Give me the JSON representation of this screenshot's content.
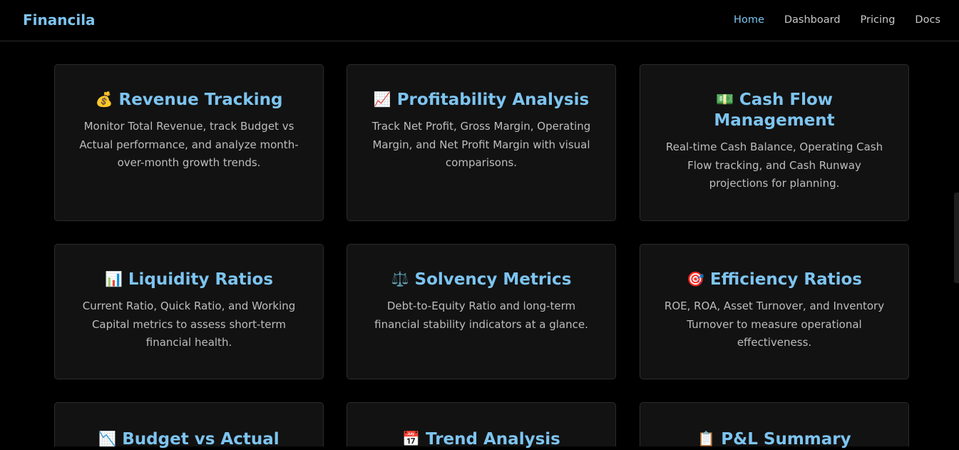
{
  "brand": "Financila",
  "nav": [
    "Home",
    "Dashboard",
    "Pricing",
    "Docs"
  ],
  "cards": [
    {
      "icon": "💰",
      "icon_name": "money-bag-icon",
      "title": "Revenue Tracking",
      "description": "Monitor Total Revenue, track Budget vs Actual performance, and analyze month-over-month growth trends."
    },
    {
      "icon": "📈",
      "icon_name": "chart-increasing-icon",
      "title": "Profitability Analysis",
      "description": "Track Net Profit, Gross Margin, Operating Margin, and Net Profit Margin with visual comparisons."
    },
    {
      "icon": "💵",
      "icon_name": "dollar-banknote-icon",
      "title": "Cash Flow Management",
      "description": "Real-time Cash Balance, Operating Cash Flow tracking, and Cash Runway projections for planning."
    },
    {
      "icon": "📊",
      "icon_name": "bar-chart-icon",
      "title": "Liquidity Ratios",
      "description": "Current Ratio, Quick Ratio, and Working Capital metrics to assess short-term financial health."
    },
    {
      "icon": "⚖️",
      "icon_name": "balance-scale-icon",
      "title": "Solvency Metrics",
      "description": "Debt-to-Equity Ratio and long-term financial stability indicators at a glance."
    },
    {
      "icon": "🎯",
      "icon_name": "target-icon",
      "title": "Efficiency Ratios",
      "description": "ROE, ROA, Asset Turnover, and Inventory Turnover to measure operational effectiveness."
    },
    {
      "icon": "📉",
      "icon_name": "chart-decreasing-icon",
      "title": "Budget vs Actual",
      "description": ""
    },
    {
      "icon": "📅",
      "icon_name": "calendar-icon",
      "title": "Trend Analysis",
      "description": ""
    },
    {
      "icon": "📋",
      "icon_name": "clipboard-icon",
      "title": "P&L Summary",
      "description": ""
    }
  ]
}
